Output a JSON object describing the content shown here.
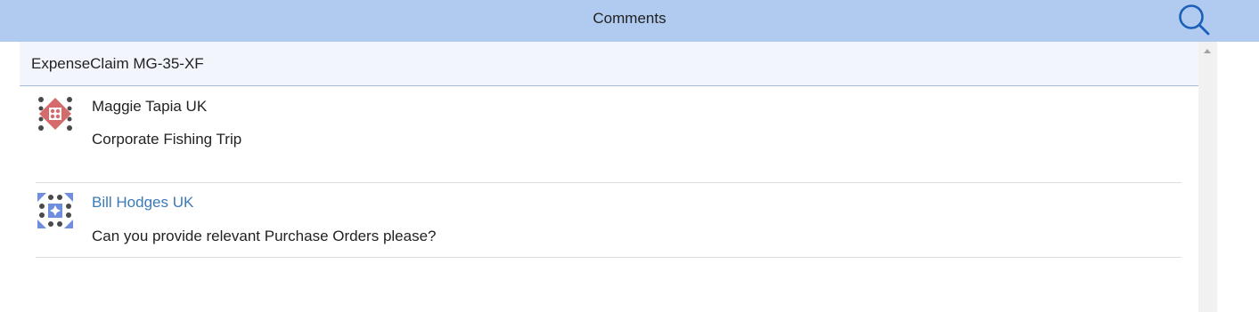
{
  "header": {
    "title": "Comments",
    "search_icon": "search-icon",
    "background_color": "#b1cbf0"
  },
  "panel": {
    "title": "ExpenseClaim MG-35-XF"
  },
  "comments": [
    {
      "author": "Maggie Tapia UK",
      "text": "Corporate Fishing Trip",
      "avatar_icon": "identicon-red",
      "avatar_color": "#d46a6a"
    },
    {
      "author": "Bill Hodges UK",
      "text": "Can you provide relevant Purchase Orders please?",
      "avatar_icon": "identicon-blue",
      "avatar_color": "#6f8ee0",
      "author_color": "#3b7ab9"
    }
  ]
}
